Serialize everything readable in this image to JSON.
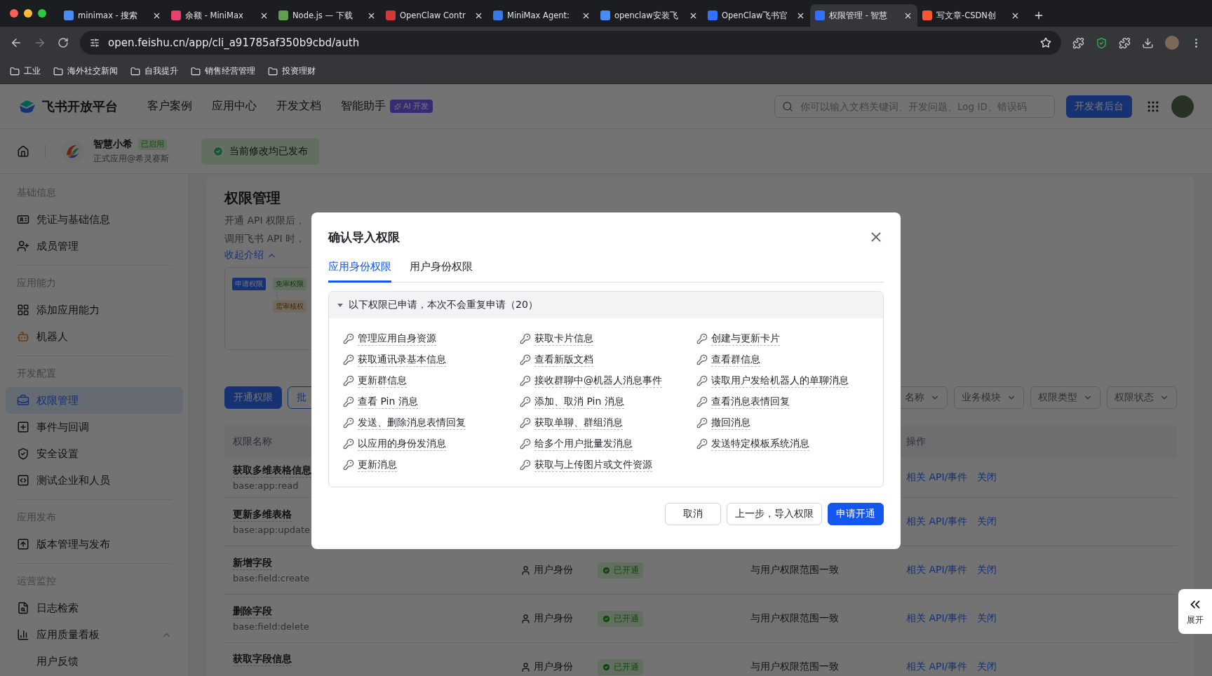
{
  "browser": {
    "tabs": [
      {
        "title": "minimax - 搜索",
        "selected": false
      },
      {
        "title": "余额 - MiniMax",
        "selected": false
      },
      {
        "title": "Node.js — 下载",
        "selected": false
      },
      {
        "title": "OpenClaw Contr",
        "selected": false
      },
      {
        "title": "MiniMax Agent:",
        "selected": false
      },
      {
        "title": "openclaw安装飞",
        "selected": false
      },
      {
        "title": "OpenClaw飞书官",
        "selected": false
      },
      {
        "title": "权限管理 - 智慧",
        "selected": true
      },
      {
        "title": "写文章-CSDN创",
        "selected": false
      }
    ],
    "address": "open.feishu.cn/app/cli_a91785af350b9cbd/auth",
    "bookmarks": [
      "工业",
      "海外社交新闻",
      "自我提升",
      "销售经营管理",
      "投资理财"
    ]
  },
  "header": {
    "logo": "飞书开放平台",
    "nav": [
      "客户案例",
      "应用中心",
      "开发文档",
      "智能助手"
    ],
    "ai_badge": "AI 开发",
    "search": {
      "placeholder": "你可以输入文档关键词、开发问题、Log ID、错误码"
    },
    "console_button": "开发者后台"
  },
  "app_bar": {
    "name": "智慧小希",
    "badge": "已启用",
    "subtitle": "正式应用@希灵赛斯",
    "notice": "当前修改均已发布"
  },
  "sidebar": {
    "sections": [
      {
        "title": "基础信息",
        "items": [
          {
            "label": "凭证与基础信息",
            "selected": false
          },
          {
            "label": "成员管理",
            "selected": false
          }
        ]
      },
      {
        "title": "应用能力",
        "items": [
          {
            "label": "添加应用能力",
            "selected": false
          },
          {
            "label": "机器人",
            "selected": false
          }
        ]
      },
      {
        "title": "开发配置",
        "items": [
          {
            "label": "权限管理",
            "selected": true
          },
          {
            "label": "事件与回调",
            "selected": false
          },
          {
            "label": "安全设置",
            "selected": false
          },
          {
            "label": "测试企业和人员",
            "selected": false
          }
        ]
      },
      {
        "title": "应用发布",
        "items": [
          {
            "label": "版本管理与发布",
            "selected": false
          }
        ]
      },
      {
        "title": "运营监控",
        "items": [
          {
            "label": "日志检索",
            "selected": false
          },
          {
            "label": "应用质量看板",
            "selected": false,
            "expanded": true,
            "children": [
              {
                "label": "用户反馈",
                "selected": false
              }
            ]
          }
        ]
      }
    ]
  },
  "page": {
    "title": "权限管理",
    "intro": [
      "开通 API 权限后，",
      "调用飞书 API 时，"
    ],
    "collapse_link": {
      "label": "收起介绍",
      "expanded": true
    },
    "diagram": {
      "chips": [
        {
          "label": "申请权限",
          "kind": "apply"
        },
        {
          "label": "免审权限",
          "kind": "auto"
        },
        {
          "label": "需审核权",
          "kind": "review"
        }
      ]
    },
    "buttons": [
      {
        "label": "开通权限",
        "kind": "primary"
      },
      {
        "label": "批",
        "kind": "default"
      }
    ],
    "filters": [
      "名称",
      "业务模块",
      "权限类型",
      "权限状态"
    ],
    "table": {
      "columns": [
        {
          "label": "权限名称"
        },
        {
          "label": "操作"
        }
      ],
      "rows": [
        {
          "name": "获取多维表格信息",
          "scope": "base:app:read",
          "actions": [
            "相关 API/事件",
            "关闭"
          ]
        },
        {
          "name": "更新多维表格",
          "scope": "base:app:update",
          "actions": [
            "相关 API/事件",
            "关闭"
          ]
        },
        {
          "name": "新增字段",
          "scope": "base:field:create",
          "identity": "用户身份",
          "status": "已开通",
          "range": "与用户权限范围一致",
          "actions": [
            "相关 API/事件",
            "关闭"
          ]
        },
        {
          "name": "删除字段",
          "scope": "base:field:delete",
          "identity": "用户身份",
          "status": "已开通",
          "range": "与用户权限范围一致",
          "actions": [
            "相关 API/事件",
            "关闭"
          ]
        },
        {
          "name": "获取字段信息",
          "identity": "用户身份",
          "status": "已开通",
          "range": "与用户权限范围一致",
          "actions": [
            "相关 API/事件",
            "关闭"
          ]
        }
      ]
    }
  },
  "modal": {
    "title": "确认导入权限",
    "tabs": [
      {
        "label": "应用身份权限",
        "selected": true
      },
      {
        "label": "用户身份权限",
        "selected": false
      }
    ],
    "group": {
      "title": "以下权限已申请，本次不会重复申请（20）",
      "expanded": true,
      "items": [
        "管理应用自身资源",
        "获取卡片信息",
        "创建与更新卡片",
        "获取通讯录基本信息",
        "查看新版文档",
        "查看群信息",
        "更新群信息",
        "接收群聊中@机器人消息事件",
        "读取用户发给机器人的单聊消息",
        "查看 Pin 消息",
        "添加、取消 Pin 消息",
        "查看消息表情回复",
        "发送、删除消息表情回复",
        "获取单聊、群组消息",
        "撤回消息",
        "以应用的身份发消息",
        "给多个用户批量发消息",
        "发送特定模板系统消息",
        "更新消息",
        "获取与上传图片或文件资源"
      ]
    },
    "buttons": [
      {
        "label": "取消",
        "kind": "default"
      },
      {
        "label": "上一步，导入权限",
        "kind": "default"
      },
      {
        "label": "申请开通",
        "kind": "primary"
      }
    ]
  },
  "side_toggle": {
    "label": "展开"
  }
}
